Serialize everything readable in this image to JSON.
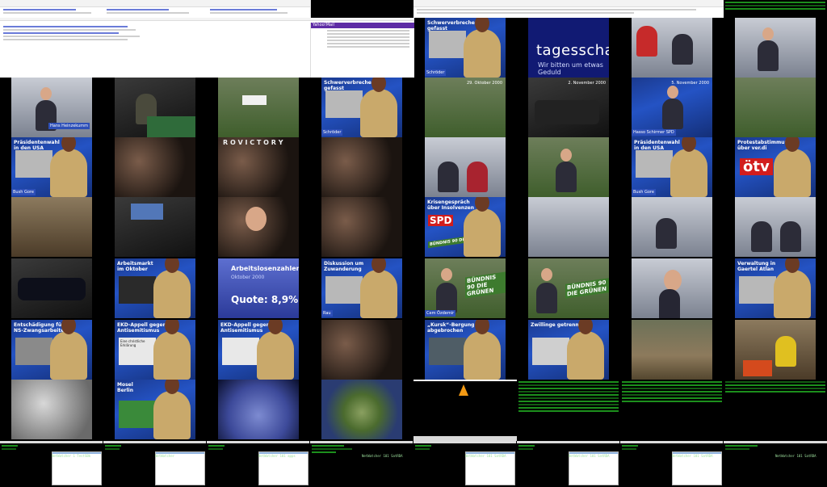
{
  "browser": {
    "menu_label": "Yahoo!Mail"
  },
  "tiles": {
    "r2c1": {
      "lower": "Hans Heinzekumm"
    },
    "r1c4": {
      "cap": "Schwerverbrecher\ngefasst",
      "lower": "Schröder"
    },
    "r1c5": {
      "logo": "tagesschau",
      "sub": "Wir bitten um etwas Geduld"
    },
    "r1c7": {
      "lower": ""
    },
    "r2c3": {
      "lower": ""
    },
    "r2c4": {
      "cap": "Schwerverbrecher\ngefasst",
      "lower": "Schröder"
    },
    "r2c5": {
      "date": "29. Oktober 2000"
    },
    "r2c6": {
      "date": "2. November 2000"
    },
    "r2c7": {
      "date": "5. November 2000",
      "lower": "Hasso Schirmer SPD"
    },
    "r3c1": {
      "cap": "Präsidentenwahl\nin den USA",
      "lower": "Bush   Gore"
    },
    "r3c3": {
      "big": "R O V I C T O R Y"
    },
    "r3c8": {
      "cap": "Präsidentenwahl\nin den USA",
      "lower": "Bush   Gore"
    },
    "r3c9": {
      "cap": "Protestabstimmung\nüber ver.di",
      "logo": "ötv"
    },
    "r4c6": {
      "cap": "Krisengespräch\nüber Insolvenzen",
      "logo": "SPD",
      "sub": "BÜNDNIS 90 DIE GRÜNEN"
    },
    "r5c2": {
      "cap": "Arbeitsmarkt\nim Oktober"
    },
    "r5c3": {
      "title": "Arbeitslosenzahlen",
      "sub": "Oktober 2000",
      "quote": "Quote: 8,9%"
    },
    "r5c4": {
      "cap": "Diskussion um\nZuwanderung",
      "lower": "Rau"
    },
    "r5c5": {
      "lower": "Cem Özdemir",
      "logo": "BÜNDNIS 90 DIE GRÜNEN"
    },
    "r5c6": {
      "logo": "BÜNDNIS 90 DIE GRÜNEN"
    },
    "r5c9": {
      "cap": "Verwaltung in\nGaertel Atlan",
      "lower": ""
    },
    "r6c1": {
      "cap": "Entschädigung für\nNS-Zwangsarbeiter"
    },
    "r6c2": {
      "cap": "EKD-Appell gegen\nAntisemitismus",
      "sub": "Eine christliche\nErklärung"
    },
    "r6c3": {
      "cap": "EKD-Appell gegen\nAntisemitismus"
    },
    "r6c5": {
      "cap": "„Kursk“-Bergung\nabgebrochen",
      "lower": ""
    },
    "r6c6": {
      "cap": "Zwillinge getrennt",
      "lower": ""
    },
    "r7c2": {
      "cap": "Mosel\nBerlin",
      "lower": ""
    }
  },
  "terminal": {
    "panel_titles": [
      "NetWatcher  1  TestSBk",
      "NetWatcher",
      "NetWatcher 101  apps",
      "NetWatcher 101  SatRDA",
      "NetWatcher 101  SatRDA",
      "NetWatcher 101  SatRDA",
      "NetWatcher 101  SatRDA",
      "NetWatcher 101  SatRDA"
    ]
  },
  "colors": {
    "studio_blue": "#2453c4",
    "tagesschau_blue": "#111a73",
    "terminal_green": "#2bd92b",
    "anchor_jacket": "#c9a96b"
  }
}
